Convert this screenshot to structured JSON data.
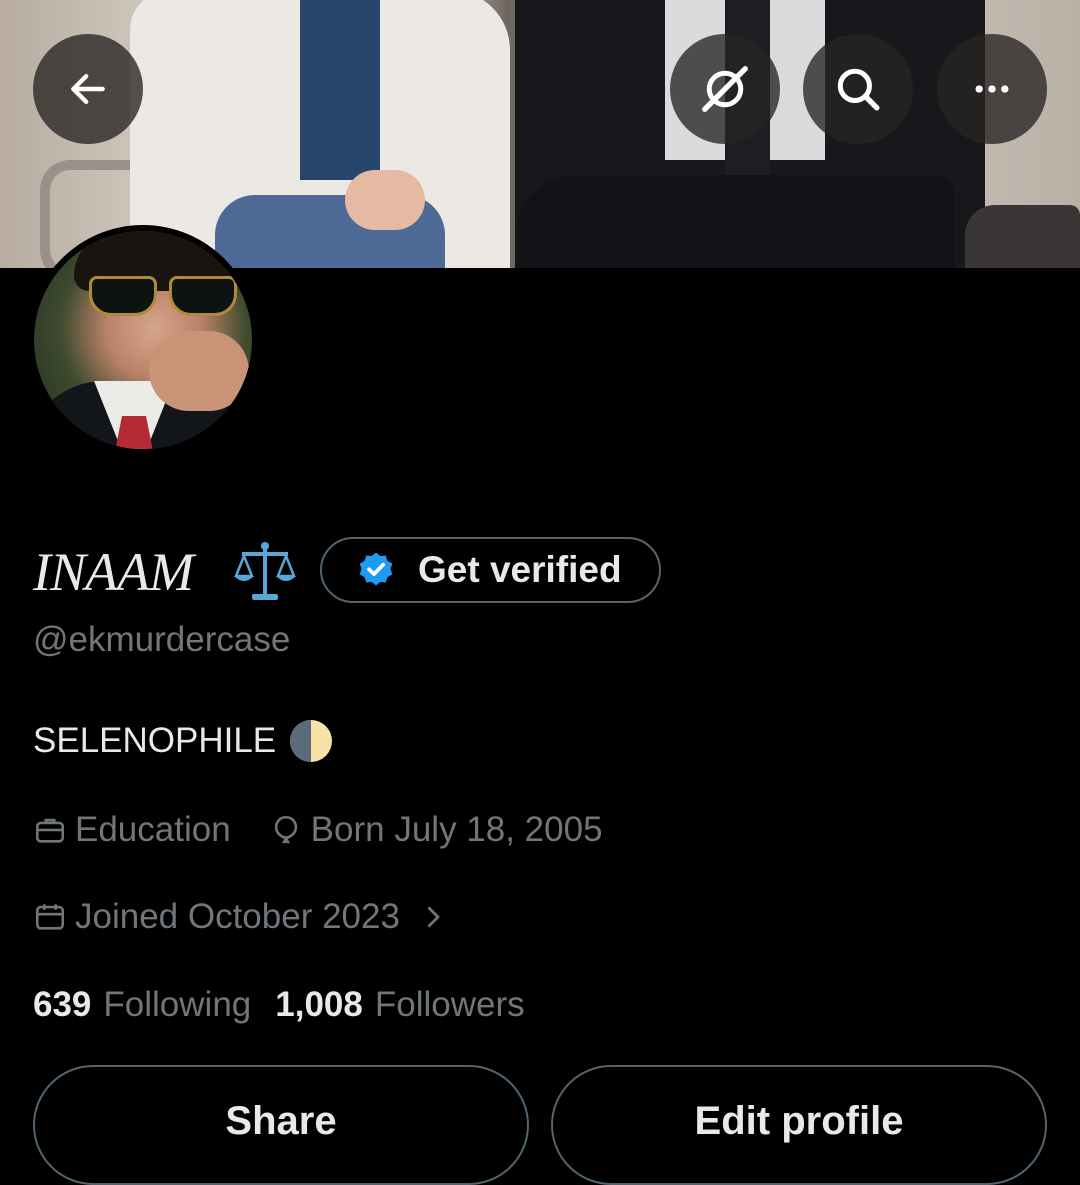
{
  "top_bar": {
    "back_icon": "arrow-left-icon",
    "grok_icon": "grok-icon",
    "search_icon": "search-icon",
    "more_icon": "more-horizontal-icon"
  },
  "profile": {
    "display_name": "INAAM",
    "name_emoji": "balance-scale-emoji",
    "handle": "@ekmurdercase",
    "bio": "SELENOPHILE",
    "bio_emoji": "first-quarter-moon-emoji",
    "category": "Education",
    "born": "Born July 18, 2005",
    "joined": "Joined October 2023"
  },
  "verify_button": {
    "label": "Get verified",
    "icon": "verified-badge-icon",
    "badge_color": "#1d9bf0"
  },
  "stats": {
    "following_count": "639",
    "following_label": "Following",
    "followers_count": "1,008",
    "followers_label": "Followers"
  },
  "actions": {
    "share_label": "Share",
    "edit_label": "Edit profile"
  },
  "colors": {
    "background": "#000000",
    "primary_text": "#e7e9ea",
    "secondary_text": "#71767b",
    "border": "#536471"
  }
}
